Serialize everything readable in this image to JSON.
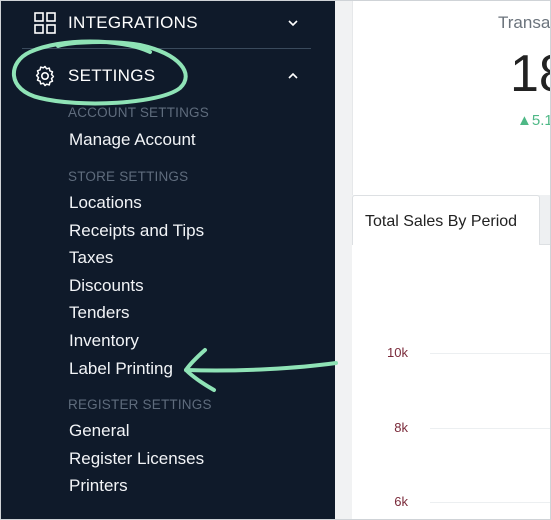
{
  "sidebar": {
    "integrations": {
      "label": "INTEGRATIONS",
      "icon": "grid-icon"
    },
    "settings": {
      "label": "SETTINGS",
      "icon": "gear-icon"
    },
    "sections": [
      {
        "title": "ACCOUNT SETTINGS",
        "items": [
          "Manage Account"
        ]
      },
      {
        "title": "STORE SETTINGS",
        "items": [
          "Locations",
          "Receipts and Tips",
          "Taxes",
          "Discounts",
          "Tenders",
          "Inventory",
          "Label Printing"
        ]
      },
      {
        "title": "REGISTER SETTINGS",
        "items": [
          "General",
          "Register Licenses",
          "Printers"
        ]
      }
    ],
    "colors": {
      "background": "#0f1a2a",
      "section": "#5f6c7d",
      "annotation": "#8fe3b6"
    }
  },
  "main": {
    "stat": {
      "label": "Transa",
      "value": "18",
      "change": "▲5.1"
    },
    "chart": {
      "tab": "Total Sales By Period",
      "ticks": [
        "10k",
        "8k",
        "6k"
      ]
    }
  }
}
